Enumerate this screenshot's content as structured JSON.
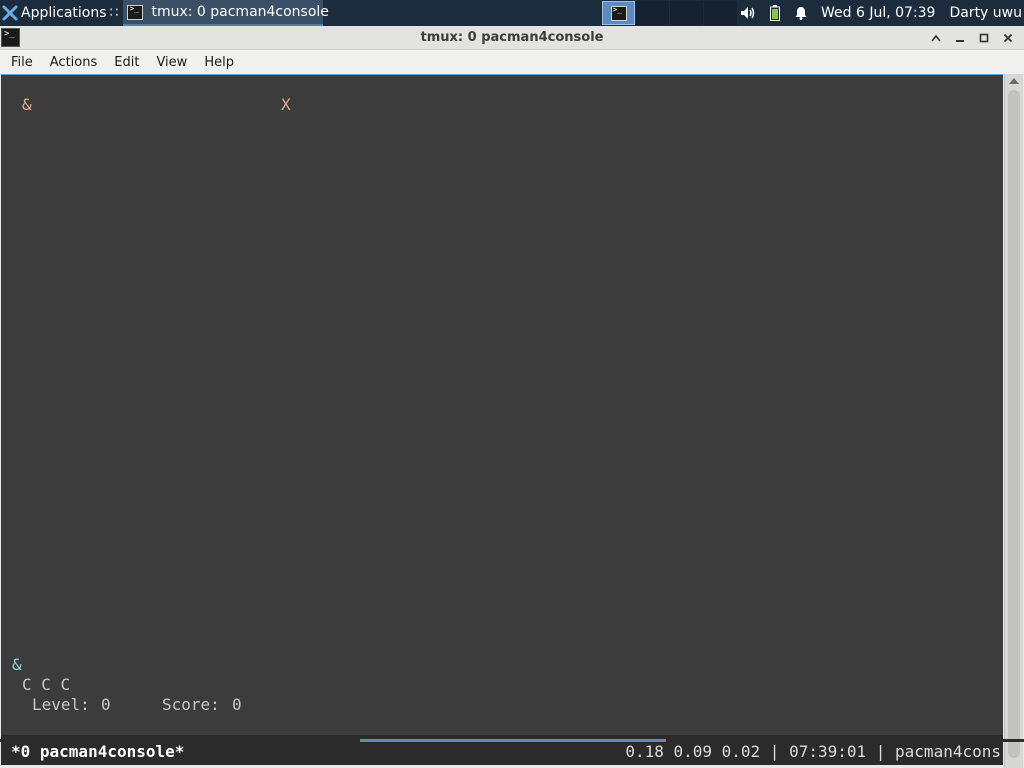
{
  "panel": {
    "apps_label": "Applications",
    "apps_sep": "∷",
    "task_label": "tmux: 0 pacman4console",
    "clock": "Wed  6 Jul, 07:39",
    "user": "Darty uwu"
  },
  "window": {
    "title": "tmux: 0 pacman4console",
    "menu": [
      "File",
      "Actions",
      "Edit",
      "View",
      "Help"
    ]
  },
  "terminal": {
    "top_line": {
      "left": "&",
      "right": "X"
    },
    "bottom_symbol": "&",
    "lives": "C C C",
    "level_label": "Level:",
    "level": "0",
    "score_label": "Score:",
    "score": "0"
  },
  "tmux": {
    "left": "*0 pacman4console*",
    "right": "0.18 0.09 0.02 | 07:39:01 | pacman4cons"
  },
  "colors": {
    "terminal_bg": "#3c3c3c",
    "panel_bg": "#1d2c3c",
    "accent": "#5e8bbf",
    "salmon": "#e8a88c",
    "cyan": "#96d6d6"
  }
}
